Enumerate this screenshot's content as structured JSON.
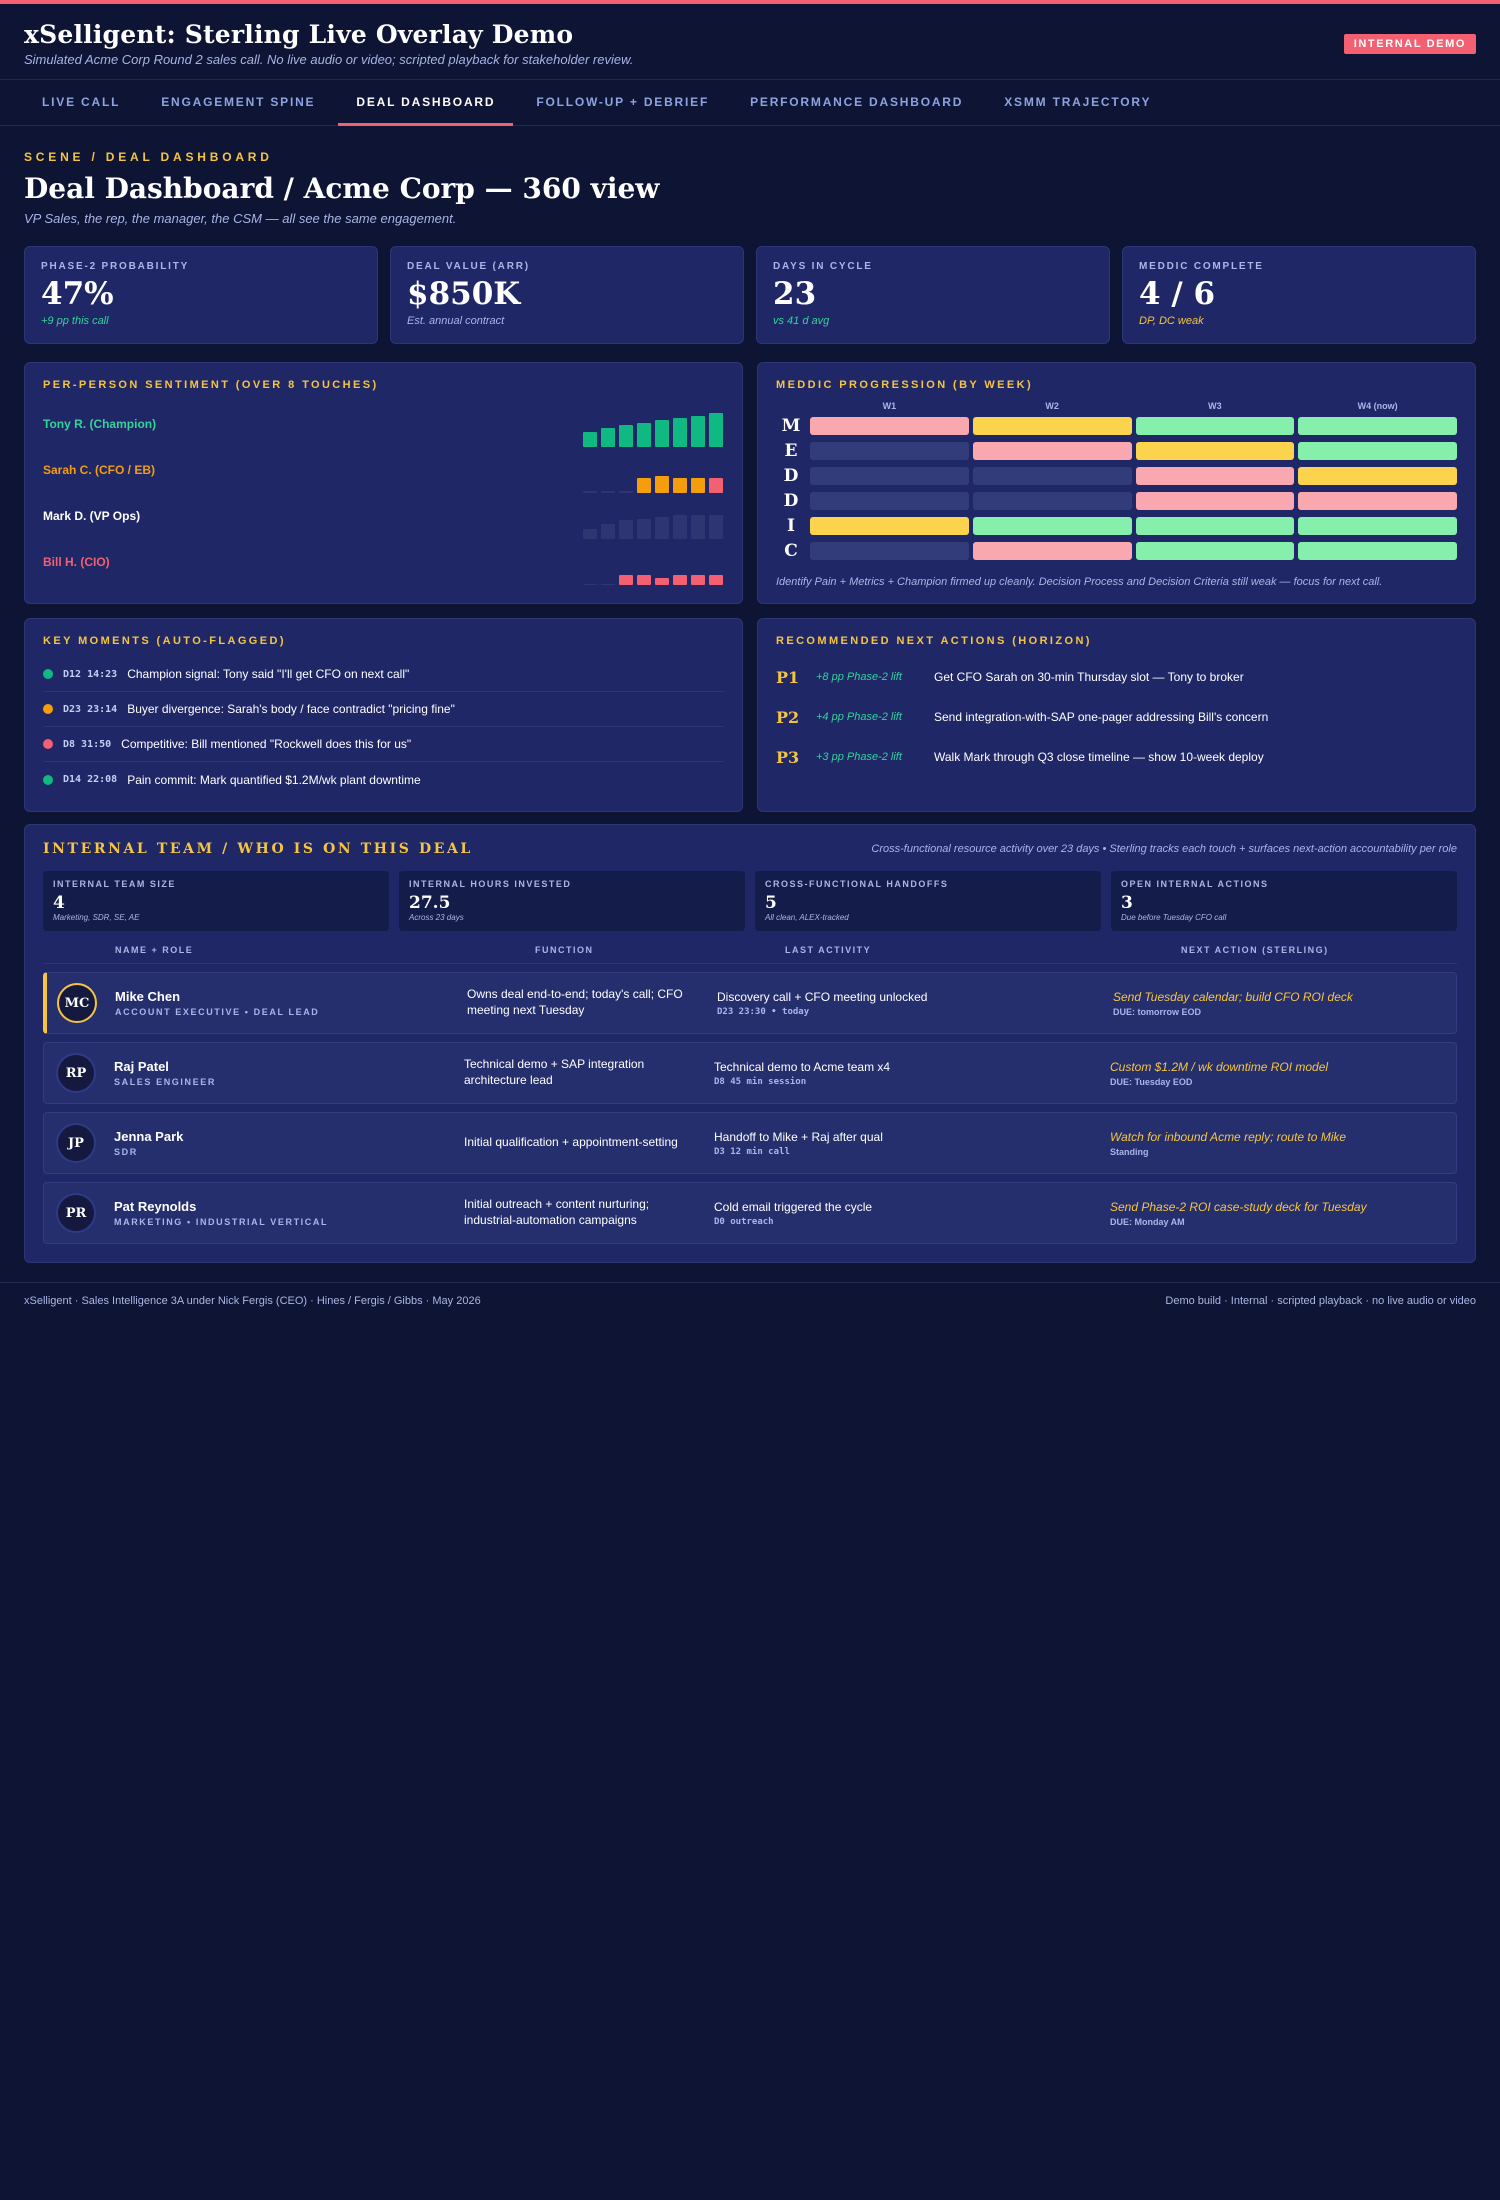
{
  "app": {
    "title": "xSelligent: Sterling Live Overlay Demo",
    "subtitle": "Simulated Acme Corp Round 2 sales call. No live audio or video; scripted playback for stakeholder review.",
    "badge": "INTERNAL DEMO"
  },
  "tabs": [
    {
      "label": "LIVE CALL",
      "active": false
    },
    {
      "label": "ENGAGEMENT SPINE",
      "active": false
    },
    {
      "label": "DEAL DASHBOARD",
      "active": true
    },
    {
      "label": "FOLLOW-UP + DEBRIEF",
      "active": false
    },
    {
      "label": "PERFORMANCE DASHBOARD",
      "active": false
    },
    {
      "label": "XSMM TRAJECTORY",
      "active": false
    }
  ],
  "scene": {
    "eyebrow": "SCENE / DEAL DASHBOARD",
    "title": "Deal Dashboard / Acme Corp — 360 view",
    "subtitle": "VP Sales, the rep, the manager, the CSM — all see the same engagement."
  },
  "kpis": [
    {
      "label": "PHASE-2 PROBABILITY",
      "value": "47%",
      "note": "+9 pp this call",
      "note_color": "#34d399"
    },
    {
      "label": "DEAL VALUE (ARR)",
      "value": "$850K",
      "note": "Est. annual contract",
      "note_color": "#aab6e8"
    },
    {
      "label": "DAYS IN CYCLE",
      "value": "23",
      "note": "vs 41 d avg",
      "note_color": "#34d399"
    },
    {
      "label": "MEDDIC COMPLETE",
      "value": "4 / 6",
      "note": "DP, DC weak",
      "note_color": "#f5c542"
    }
  ],
  "sentiment": {
    "title": "PER-PERSON SENTIMENT (OVER 8 TOUCHES)",
    "people": [
      {
        "name": "Tony R. (Champion)",
        "color": "#34d399",
        "touches": [
          0.45,
          0.55,
          0.65,
          0.72,
          0.78,
          0.85,
          0.9,
          1.0
        ],
        "bar_colors": [
          "#10b981",
          "#10b981",
          "#10b981",
          "#10b981",
          "#10b981",
          "#10b981",
          "#10b981",
          "#10b981"
        ]
      },
      {
        "name": "Sarah C. (CFO / EB)",
        "color": "#f59e0b",
        "touches": [
          0.05,
          0.05,
          0.05,
          0.45,
          0.5,
          0.45,
          0.45,
          0.45
        ],
        "bar_colors": [
          "#2d3670",
          "#2d3670",
          "#2d3670",
          "#f59e0b",
          "#f59e0b",
          "#f59e0b",
          "#f59e0b",
          "#f26072"
        ]
      },
      {
        "name": "Mark D. (VP Ops)",
        "color": "#ffffff",
        "touches": [
          0.3,
          0.45,
          0.55,
          0.6,
          0.65,
          0.7,
          0.7,
          0.7
        ],
        "bar_colors": [
          "#2d3670",
          "#2d3670",
          "#2d3670",
          "#2d3670",
          "#2d3670",
          "#2d3670",
          "#2d3670",
          "#2d3670"
        ]
      },
      {
        "name": "Bill H. (CIO)",
        "color": "#f26072",
        "touches": [
          0.04,
          0.04,
          0.3,
          0.3,
          0.22,
          0.3,
          0.3,
          0.3
        ],
        "bar_colors": [
          "#2d3670",
          "#2d3670",
          "#f26072",
          "#f26072",
          "#f26072",
          "#f26072",
          "#f26072",
          "#f26072"
        ]
      }
    ]
  },
  "meddic": {
    "title": "MEDDIC PROGRESSION (BY WEEK)",
    "weeks": [
      "W1",
      "W2",
      "W3",
      "W4 (now)"
    ],
    "rows": [
      {
        "letter": "M",
        "cells": [
          "#f9a8b0",
          "#fcd34d",
          "#86efac",
          "#86efac"
        ]
      },
      {
        "letter": "E",
        "cells": [
          "#323c7a",
          "#f9a8b0",
          "#fcd34d",
          "#86efac"
        ]
      },
      {
        "letter": "D",
        "cells": [
          "#323c7a",
          "#323c7a",
          "#f9a8b0",
          "#fcd34d"
        ]
      },
      {
        "letter": "D",
        "cells": [
          "#323c7a",
          "#323c7a",
          "#f9a8b0",
          "#f9a8b0"
        ]
      },
      {
        "letter": "I",
        "cells": [
          "#fcd34d",
          "#86efac",
          "#86efac",
          "#86efac"
        ]
      },
      {
        "letter": "C",
        "cells": [
          "#323c7a",
          "#f9a8b0",
          "#86efac",
          "#86efac"
        ]
      }
    ],
    "note": "Identify Pain + Metrics + Champion firmed up cleanly. Decision Process and Decision Criteria still weak — focus for next call."
  },
  "moments": {
    "title": "KEY MOMENTS (AUTO-FLAGGED)",
    "items": [
      {
        "time": "D12 14:23",
        "text": "Champion signal: Tony said \"I'll get CFO on next call\"",
        "color": "#10b981"
      },
      {
        "time": "D23 23:14",
        "text": "Buyer divergence: Sarah's body / face contradict \"pricing fine\"",
        "color": "#f59e0b"
      },
      {
        "time": "D8 31:50",
        "text": "Competitive: Bill mentioned \"Rockwell does this for us\"",
        "color": "#f26072"
      },
      {
        "time": "D14 22:08",
        "text": "Pain commit: Mark quantified $1.2M/wk plant downtime",
        "color": "#10b981"
      }
    ]
  },
  "actions": {
    "title": "RECOMMENDED NEXT ACTIONS (HORIZON)",
    "items": [
      {
        "priority": "P1",
        "lift": "+8 pp Phase-2 lift",
        "text": "Get CFO Sarah on 30-min Thursday slot — Tony to broker"
      },
      {
        "priority": "P2",
        "lift": "+4 pp Phase-2 lift",
        "text": "Send integration-with-SAP one-pager addressing Bill's concern"
      },
      {
        "priority": "P3",
        "lift": "+3 pp Phase-2 lift",
        "text": "Walk Mark through Q3 close timeline — show 10-week deploy"
      }
    ]
  },
  "team": {
    "title": "INTERNAL TEAM / WHO IS ON THIS DEAL",
    "subtitle": "Cross-functional resource activity over 23 days • Sterling tracks each touch + surfaces next-action accountability per role",
    "kpis": [
      {
        "label": "INTERNAL TEAM SIZE",
        "value": "4",
        "note": "Marketing, SDR, SE, AE"
      },
      {
        "label": "INTERNAL HOURS INVESTED",
        "value": "27.5",
        "note": "Across 23 days"
      },
      {
        "label": "CROSS-FUNCTIONAL HANDOFFS",
        "value": "5",
        "note": "All clean, ALEX-tracked"
      },
      {
        "label": "OPEN INTERNAL ACTIONS",
        "value": "3",
        "note": "Due before Tuesday CFO call"
      }
    ],
    "columns": [
      "NAME + ROLE",
      "FUNCTION",
      "LAST ACTIVITY",
      "NEXT ACTION (STERLING)"
    ],
    "members": [
      {
        "initials": "MC",
        "name": "Mike Chen",
        "role": "ACCOUNT EXECUTIVE • DEAL LEAD",
        "function": "Owns deal end-to-end; today's call; CFO meeting next Tuesday",
        "last": "Discovery call + CFO meeting unlocked",
        "last_meta": "D23 23:30 • today",
        "next": "Send Tuesday calendar; build CFO ROI deck",
        "due": "DUE: tomorrow EOD",
        "lead": true
      },
      {
        "initials": "RP",
        "name": "Raj Patel",
        "role": "SALES ENGINEER",
        "function": "Technical demo + SAP integration architecture lead",
        "last": "Technical demo to Acme team x4",
        "last_meta": "D8 45 min session",
        "next": "Custom $1.2M / wk downtime ROI model",
        "due": "DUE: Tuesday EOD",
        "lead": false
      },
      {
        "initials": "JP",
        "name": "Jenna Park",
        "role": "SDR",
        "function": "Initial qualification + appointment-setting",
        "last": "Handoff to Mike + Raj after qual",
        "last_meta": "D3 12 min call",
        "next": "Watch for inbound Acme reply; route to Mike",
        "due": "Standing",
        "lead": false
      },
      {
        "initials": "PR",
        "name": "Pat Reynolds",
        "role": "MARKETING • INDUSTRIAL VERTICAL",
        "function": "Initial outreach + content nurturing; industrial-automation campaigns",
        "last": "Cold email triggered the cycle",
        "last_meta": "D0 outreach",
        "next": "Send Phase-2 ROI case-study deck for Tuesday",
        "due": "DUE: Monday AM",
        "lead": false
      }
    ]
  },
  "footer": {
    "left": "xSelligent · Sales Intelligence 3A under Nick Fergis (CEO) · Hines / Fergis / Gibbs · May 2026",
    "right": "Demo build · Internal · scripted playback · no live audio or video"
  }
}
